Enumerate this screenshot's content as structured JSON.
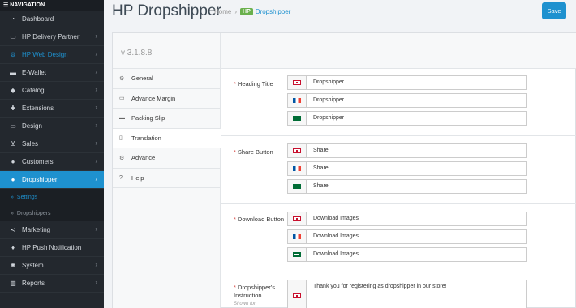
{
  "nav": {
    "header": "☰ NAVIGATION",
    "items": [
      {
        "label": "Dashboard",
        "icon": "dashboard-icon"
      },
      {
        "label": "HP Delivery Partner",
        "icon": "truck-icon"
      },
      {
        "label": "HP Web Design",
        "icon": "cogs-icon"
      },
      {
        "label": "E-Wallet",
        "icon": "card-icon"
      },
      {
        "label": "Catalog",
        "icon": "tag-icon"
      },
      {
        "label": "Extensions",
        "icon": "puzzle-icon"
      },
      {
        "label": "Design",
        "icon": "monitor-icon"
      },
      {
        "label": "Sales",
        "icon": "cart-icon"
      },
      {
        "label": "Customers",
        "icon": "user-icon"
      },
      {
        "label": "Dropshipper",
        "icon": "users-icon"
      }
    ],
    "subitems": [
      {
        "label": "Settings"
      },
      {
        "label": "Dropshippers"
      }
    ],
    "bottom_items": [
      {
        "label": "Marketing",
        "icon": "share-icon"
      },
      {
        "label": "HP Push Notification",
        "icon": "bell-icon"
      },
      {
        "label": "System",
        "icon": "gear-icon"
      },
      {
        "label": "Reports",
        "icon": "chart-icon"
      }
    ]
  },
  "header": {
    "title": "HP Dropshipper",
    "breadcrumb_home": "Home",
    "breadcrumb_sep": "›",
    "breadcrumb_badge": "HP",
    "breadcrumb_current": "Dropshipper",
    "save_label": "Save"
  },
  "panel": {
    "version": "v 3.1.8.8",
    "tabs": [
      {
        "label": "General"
      },
      {
        "label": "Advance Margin"
      },
      {
        "label": "Packing Slip"
      },
      {
        "label": "Translation"
      },
      {
        "label": "Advance"
      },
      {
        "label": "Help"
      }
    ]
  },
  "form": {
    "required_mark": "*",
    "heading_title": {
      "label": "Heading Title",
      "values": [
        "Dropshipper",
        "Dropshipper",
        "Dropshipper"
      ]
    },
    "share_button": {
      "label": "Share Button",
      "values": [
        "Share",
        "Share",
        "Share"
      ]
    },
    "download_button": {
      "label": "Download Button",
      "values": [
        "Download Images",
        "Download Images",
        "Download Images"
      ]
    },
    "instruction": {
      "label": "Dropshipper's Instruction",
      "hint": "Shown for",
      "value": "Thank you for registering as dropshipper in our store!"
    }
  },
  "colors": {
    "accent": "#1e91cf",
    "sidebar": "#23282e",
    "required": "#d9534f",
    "badge": "#6ab04c"
  }
}
